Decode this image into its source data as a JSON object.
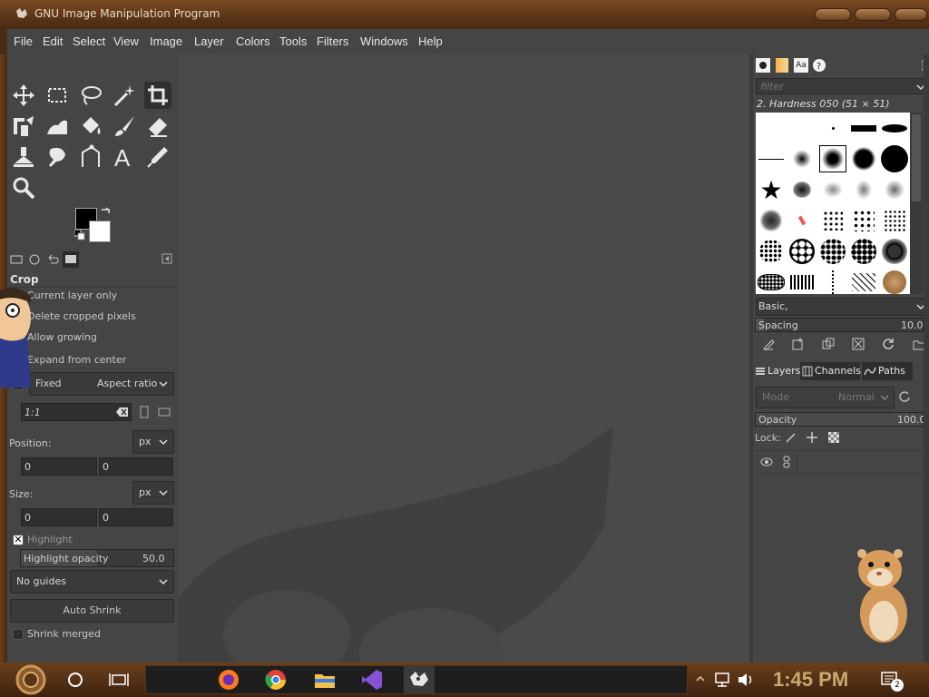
{
  "window": {
    "title": "GNU Image Manipulation Program"
  },
  "menubar": {
    "items": [
      "File",
      "Edit",
      "Select",
      "View",
      "Image",
      "Layer",
      "Colors",
      "Tools",
      "Filters",
      "Windows",
      "Help"
    ]
  },
  "tool_options": {
    "title": "Crop",
    "current_layer_only": "Current layer only",
    "delete_cropped": "Delete cropped pixels",
    "allow_growing": "Allow growing",
    "expand_from_center": "Expand from center",
    "fixed_label": "Fixed",
    "aspect_ratio": "Aspect ratio",
    "ratio_value": "1:1",
    "position_label": "Position:",
    "position_unit": "px",
    "position_x": "0",
    "position_y": "0",
    "size_label": "Size:",
    "size_unit": "px",
    "size_w": "0",
    "size_h": "0",
    "highlight_label": "Highlight",
    "highlight_opacity_label": "Highlight opacity",
    "highlight_opacity_value": "50.0",
    "guides": "No guides",
    "auto_shrink": "Auto Shrink",
    "shrink_merged": "Shrink merged"
  },
  "brushes": {
    "filter_placeholder": "filter",
    "selected_brush": "2. Hardness 050 (51 × 51)",
    "tag": "Basic,",
    "spacing_label": "Spacing",
    "spacing_value": "10.0"
  },
  "layers": {
    "tabs": [
      "Layers",
      "Channels",
      "Paths"
    ],
    "mode_label": "Mode",
    "mode_value": "Normal",
    "opacity_label": "Opacity",
    "opacity_value": "100.0",
    "lock_label": "Lock:"
  },
  "taskbar": {
    "time": "1:45 PM",
    "notification_count": "2"
  },
  "colors": {
    "accent": "#5a3418",
    "panel": "#454545",
    "canvas": "#4a4a4a",
    "clock": "#c9a96e"
  }
}
